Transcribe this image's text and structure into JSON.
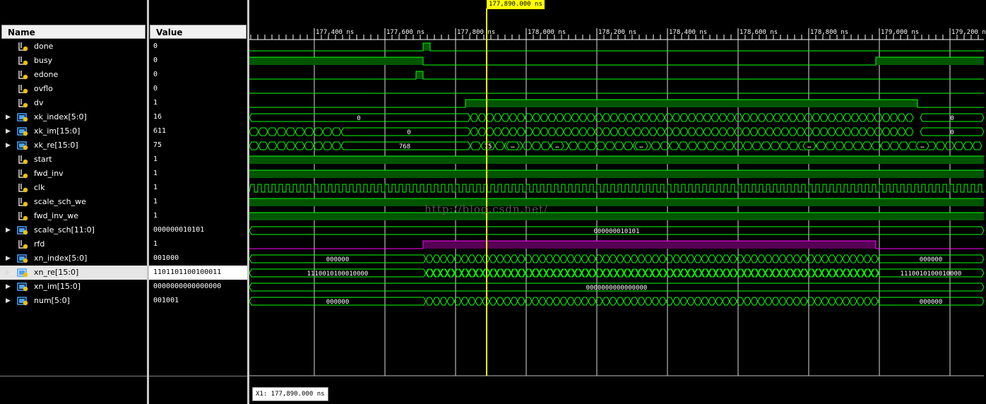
{
  "headers": {
    "name": "Name",
    "value": "Value"
  },
  "signals": [
    {
      "name": "done",
      "value": "0",
      "bus": false
    },
    {
      "name": "busy",
      "value": "0",
      "bus": false
    },
    {
      "name": "edone",
      "value": "0",
      "bus": false
    },
    {
      "name": "ovflo",
      "value": "0",
      "bus": false
    },
    {
      "name": "dv",
      "value": "1",
      "bus": false
    },
    {
      "name": "xk_index[5:0]",
      "value": "16",
      "bus": true
    },
    {
      "name": "xk_im[15:0]",
      "value": "611",
      "bus": true
    },
    {
      "name": "xk_re[15:0]",
      "value": "75",
      "bus": true
    },
    {
      "name": "start",
      "value": "1",
      "bus": false
    },
    {
      "name": "fwd_inv",
      "value": "1",
      "bus": false
    },
    {
      "name": "clk",
      "value": "1",
      "bus": false
    },
    {
      "name": "scale_sch_we",
      "value": "1",
      "bus": false
    },
    {
      "name": "fwd_inv_we",
      "value": "1",
      "bus": false
    },
    {
      "name": "scale_sch[11:0]",
      "value": "000000010101",
      "bus": true
    },
    {
      "name": "rfd",
      "value": "1",
      "bus": false
    },
    {
      "name": "xn_index[5:0]",
      "value": "001000",
      "bus": true
    },
    {
      "name": "xn_re[15:0]",
      "value": "1101101100100011",
      "bus": true,
      "selected": true
    },
    {
      "name": "xn_im[15:0]",
      "value": "0000000000000000",
      "bus": true
    },
    {
      "name": "num[5:0]",
      "value": "001001",
      "bus": true
    }
  ],
  "time_ticks": [
    "177,400 ns",
    "177,600 ns",
    "177,800 ns",
    "178,000 ns",
    "178,200 ns",
    "178,400 ns",
    "178,600 ns",
    "178,800 ns",
    "179,000 ns",
    "179,200 ns"
  ],
  "cursor": {
    "label": "177,890.000 ns",
    "x1_readout": "X1: 177,890.000 ns"
  },
  "bus_labels": {
    "xk_index_before": "0",
    "xk_index_after": "0",
    "xk_im_mid": "0",
    "xk_im_after": "0",
    "xk_re_mid": "768",
    "xk_re_at_cursor": "75",
    "scale_sch": "000000010101",
    "xn_index_before": "000000",
    "xn_index_after": "000000",
    "xn_re_before": "1110010100010000",
    "xn_re_after": "1110010100010000",
    "xn_im": "0000000000000000",
    "num_before": "000000",
    "num_after": "000000",
    "ellipsis": "…"
  },
  "watermark": "http://blog.csdn.net/",
  "colors": {
    "wave": "#00ff00",
    "fill": "#005500",
    "rfd": "#ff00ff",
    "rfd_fill": "#550055",
    "cursor": "#ffff00",
    "grid": "#ffffff"
  }
}
